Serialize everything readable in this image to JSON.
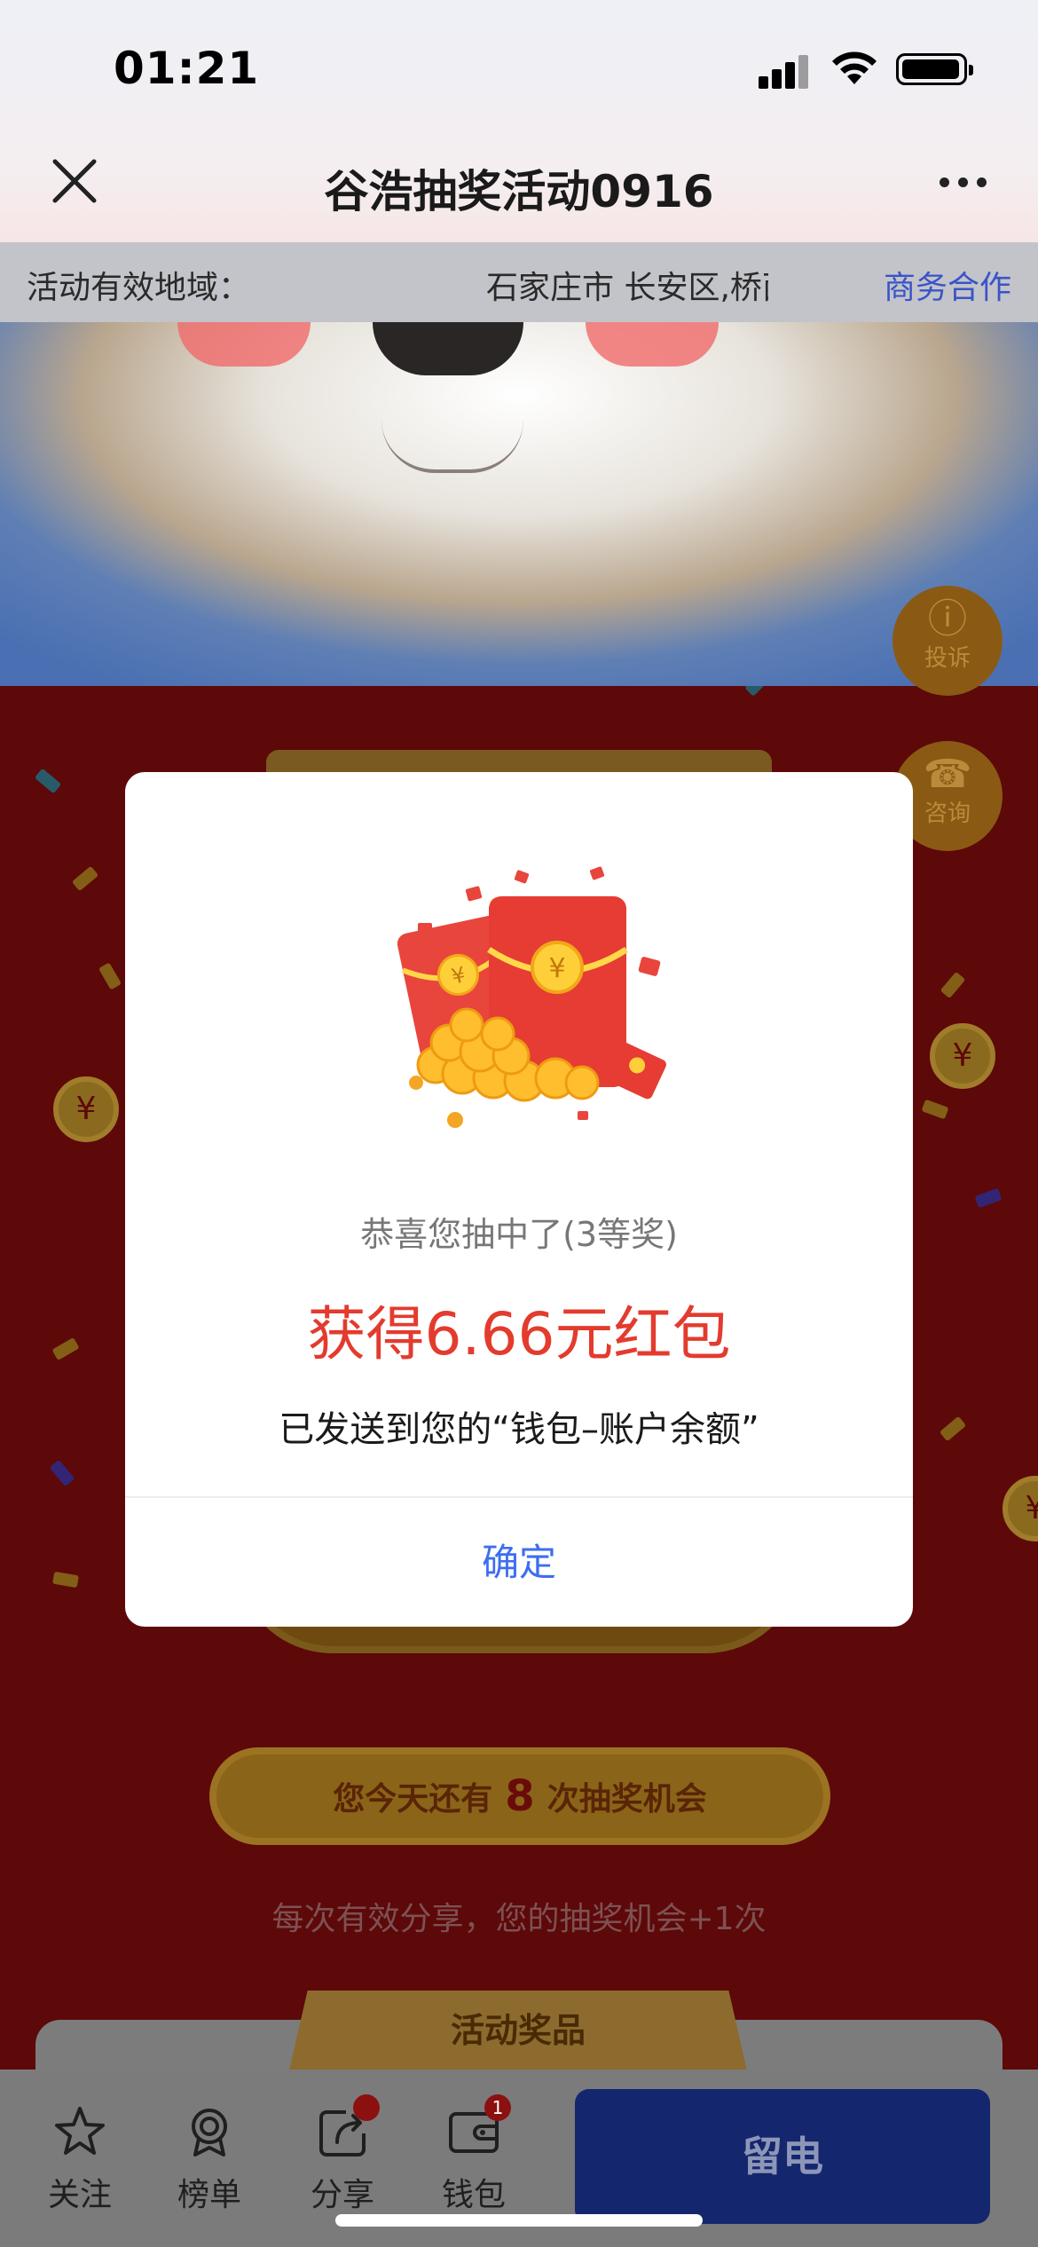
{
  "status_bar": {
    "time": "01:21"
  },
  "nav": {
    "title": "谷浩抽奖活动0916"
  },
  "region": {
    "label": "活动有效地域：",
    "value": "石家庄市 长安区,桥西区",
    "link": "商务合作"
  },
  "side_buttons": {
    "complain": "投诉",
    "consult": "咨询"
  },
  "lottery": {
    "chances_prefix": "您今天还有",
    "chances_count": "8",
    "chances_suffix": "次抽奖机会",
    "share_tip": "每次有效分享，您的抽奖机会+1次",
    "prize_section_title": "活动奖品"
  },
  "tabbar": {
    "follow": "关注",
    "ranking": "榜单",
    "share": "分享",
    "wallet": "钱包",
    "wallet_badge": "1",
    "leave_contact": "留电"
  },
  "modal": {
    "subtitle": "恭喜您抽中了(3等奖)",
    "prize": "获得6.66元红包",
    "note": "已发送到您的“钱包–账户余额”",
    "confirm": "确定"
  },
  "colors": {
    "accent_blue": "#3d6ef0",
    "prize_red": "#e33b2e",
    "festive_bg": "#5d0809"
  }
}
